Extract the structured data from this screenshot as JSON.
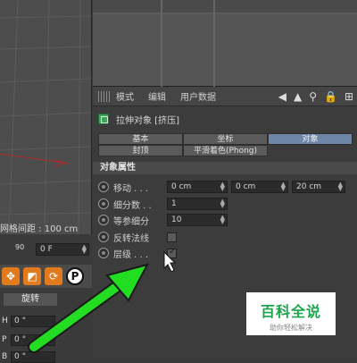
{
  "viewport": {
    "grid_spacing_text": "网格间距 : 100 cm"
  },
  "attr_manager": {
    "menu": [
      "模式",
      "编辑",
      "用户数据"
    ],
    "object_title": "拉伸对象 [挤压]",
    "tabs_row1": [
      "基本",
      "坐标",
      "对象"
    ],
    "tabs_row2": [
      "封顶",
      "平滑着色(Phong)",
      ""
    ],
    "active_tab": "对象",
    "section_title": "对象属性",
    "properties": {
      "move": {
        "label": "移动 . . .",
        "values": [
          "0 cm",
          "0 cm",
          "20 cm"
        ]
      },
      "subdivision": {
        "label": "细分数 . .",
        "value": "1"
      },
      "iso_subdivision": {
        "label": "等参细分",
        "value": "10"
      },
      "flip_normals": {
        "label": "反转法线",
        "checked": false
      },
      "hierarchical": {
        "label": "层级 . . .",
        "checked": true
      }
    }
  },
  "timeline": {
    "tick_label": "90",
    "frame_value": "0 F"
  },
  "coords": {
    "rotate_tab": "旋转",
    "rows": [
      {
        "label": "H",
        "value": "0 °"
      },
      {
        "label": "P",
        "value": "0 °"
      },
      {
        "label": "B",
        "value": "0 °"
      }
    ]
  },
  "toolbar": {
    "icons": [
      "move-tool-icon",
      "scale-tool-icon",
      "rotate-tool-icon",
      "record-icon"
    ]
  },
  "watermark": {
    "title": "百科全说",
    "subtitle": "助你轻松解决"
  },
  "colors": {
    "active_tab": "#6e86a8",
    "annotation_arrow": "#22dd22",
    "tool_orange": "#e27a1e"
  }
}
